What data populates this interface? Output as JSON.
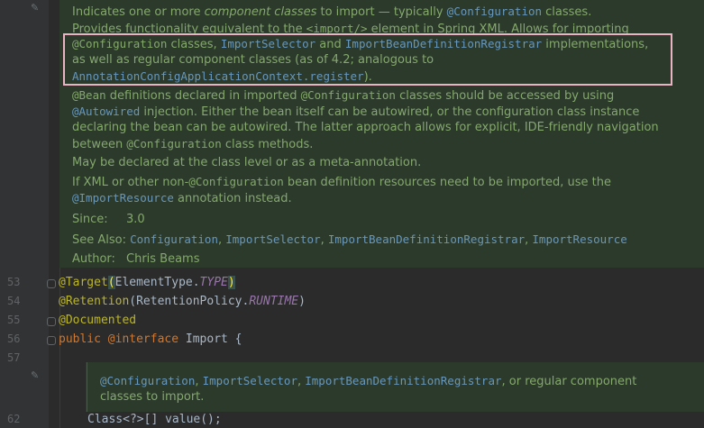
{
  "doc": {
    "l1": {
      "t1": "Indicates one or more ",
      "t2": "component classes",
      "t3": " to import — typically ",
      "t4": "@Configuration",
      "t5": " classes."
    },
    "l2": {
      "t1": "Provides functionality equivalent to the ",
      "t2": "<import/>",
      "t3": " element in Spring XML. Allows for importing"
    },
    "l3": {
      "t1": "@Configuration",
      "t2": " classes, ",
      "t3": "ImportSelector",
      "t4": " and ",
      "t5": "ImportBeanDefinitionRegistrar",
      "t6": " implementations,"
    },
    "l4": "as well as regular component classes (as of 4.2; analogous to",
    "l5": {
      "t1": "AnnotationConfigApplicationContext.register",
      "t2": ")."
    },
    "l6": {
      "t1": "@Bean",
      "t2": " definitions declared in imported ",
      "t3": "@Configuration",
      "t4": " classes should be accessed by using"
    },
    "l7": {
      "t1": "@Autowired",
      "t2": " injection. Either the bean itself can be autowired, or the configuration class instance"
    },
    "l8": "declaring the bean can be autowired. The latter approach allows for explicit, IDE-friendly navigation",
    "l9": {
      "t1": "between ",
      "t2": "@Configuration",
      "t3": " class methods."
    },
    "l10": "May be declared at the class level or as a meta-annotation.",
    "l11": {
      "t1": "If XML or other non-",
      "t2": "@Configuration",
      "t3": " bean definition resources need to be imported, use the"
    },
    "l12": {
      "t1": "@ImportResource",
      "t2": " annotation instead."
    },
    "since_label": "Since:",
    "since_value": "3.0",
    "see_label": "See Also:",
    "see_links": [
      "Configuration",
      "ImportSelector",
      "ImportBeanDefinitionRegistrar",
      "ImportResource"
    ],
    "author_label": "Author:",
    "author_value": "Chris Beams"
  },
  "code": {
    "lines": [
      {
        "num": "53",
        "a": "@Target",
        "b": "(",
        "c": "ElementType.",
        "d": "TYPE",
        "e": ")"
      },
      {
        "num": "54",
        "a": "@Retention",
        "b": "(RetentionPolicy.",
        "d": "RUNTIME",
        "e": ")"
      },
      {
        "num": "55",
        "a": "@Documented"
      },
      {
        "num": "56",
        "kw1": "public ",
        "ann": "@interface ",
        "name": "Import {"
      },
      {
        "num": "57"
      }
    ],
    "doc2": {
      "l1": {
        "t1": "@Configuration",
        "t2": ", ",
        "t3": "ImportSelector",
        "t4": ", ",
        "t5": "ImportBeanDefinitionRegistrar",
        "t6": ", or regular component"
      },
      "l2": "classes to import."
    },
    "last": {
      "num": "62",
      "text": "Class<?>[] value();"
    }
  }
}
